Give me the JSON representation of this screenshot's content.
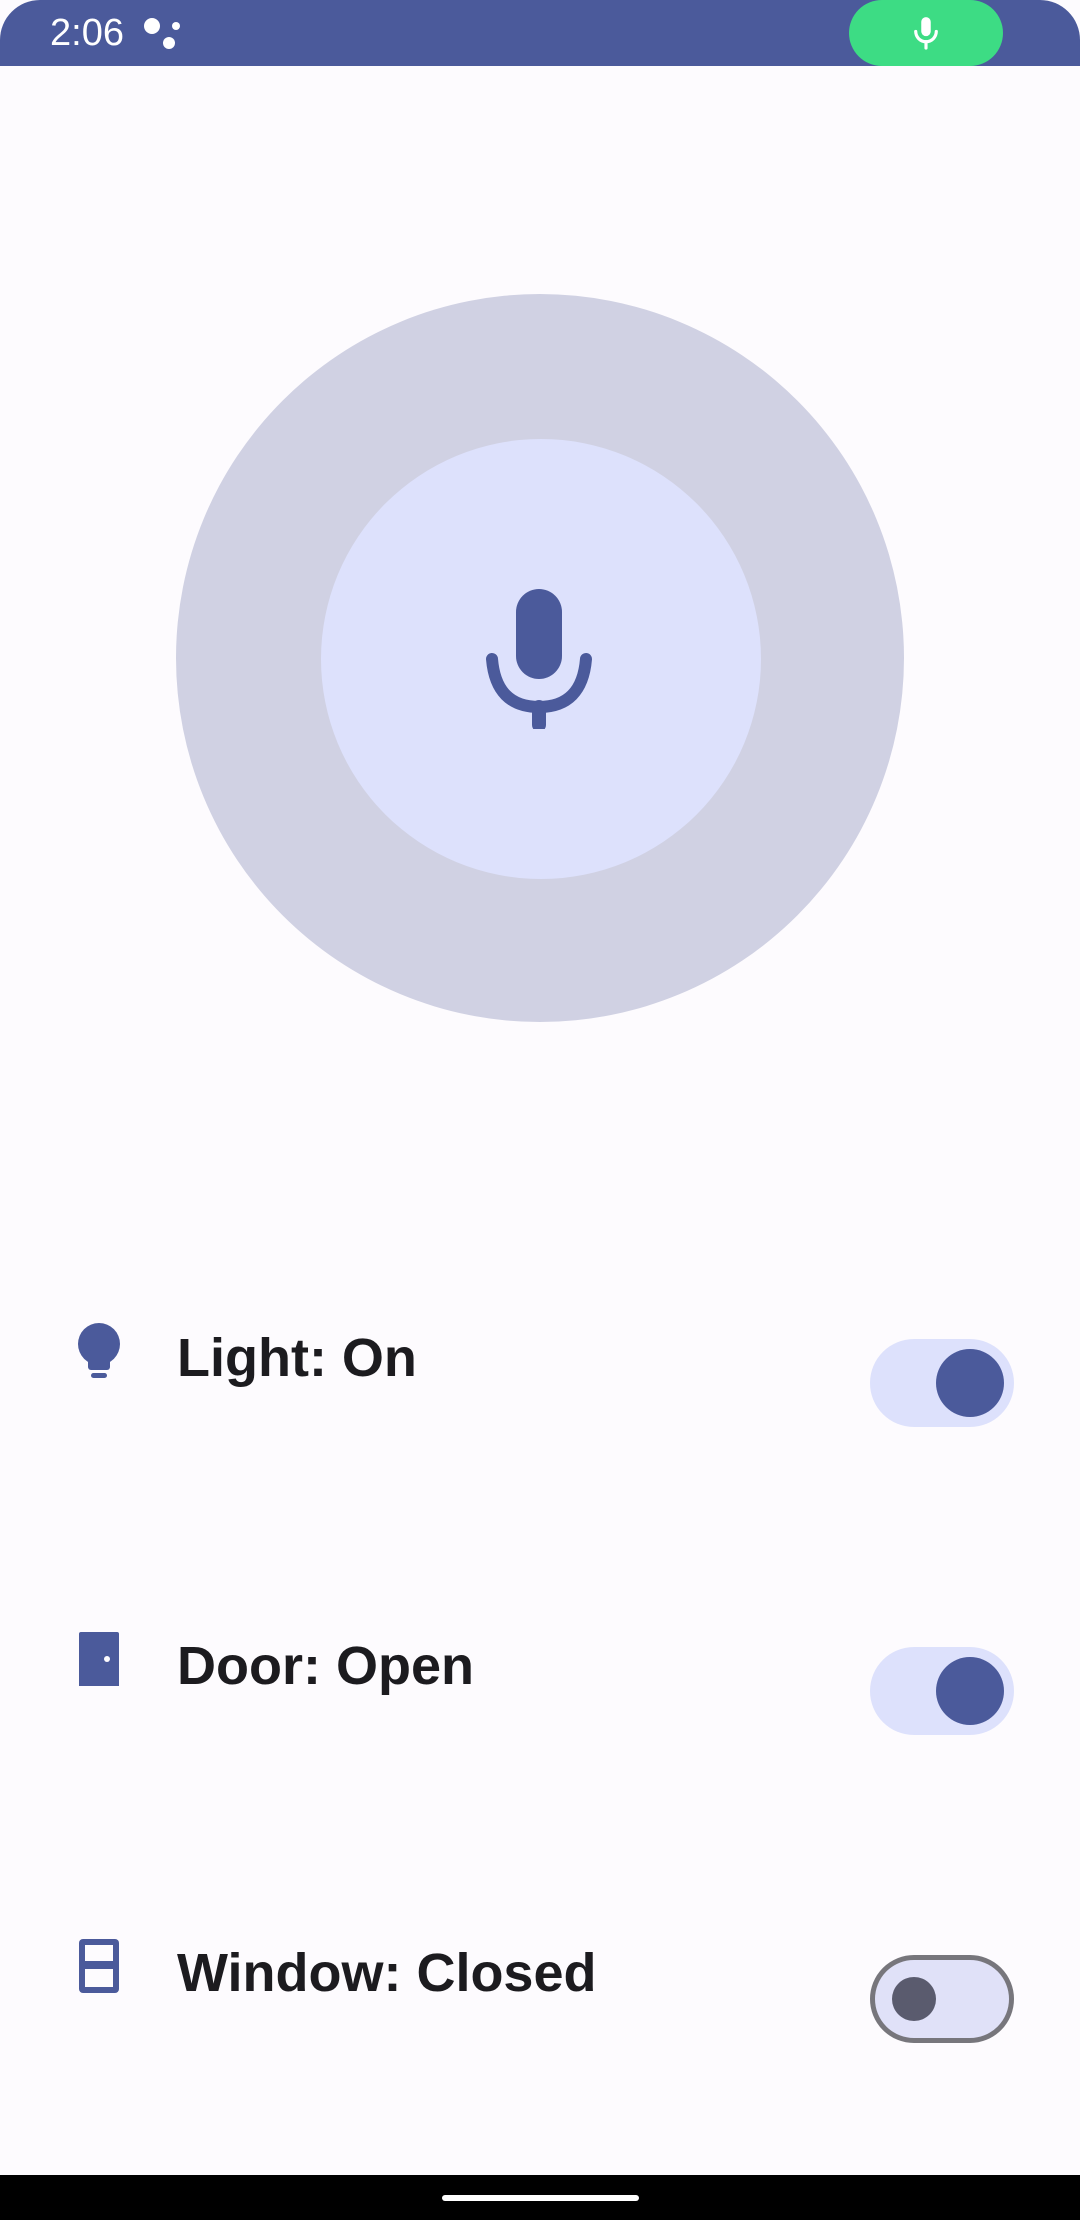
{
  "status_bar": {
    "time": "2:06",
    "background": "#4b5a9b",
    "mic_indicator_color": "#3ddc84"
  },
  "voice": {
    "icon": "mic-icon",
    "outer_color": "#d0d1e3",
    "inner_color": "#dde1fc",
    "icon_color": "#4b5a9b"
  },
  "devices": [
    {
      "icon": "lightbulb-icon",
      "label": "Light: On",
      "checked": true
    },
    {
      "icon": "door-icon",
      "label": "Door: Open",
      "checked": true
    },
    {
      "icon": "window-icon",
      "label": "Window: Closed",
      "checked": false
    }
  ],
  "colors": {
    "primary": "#4b5a9b",
    "background": "#fdfbfe",
    "text": "#1c1b1f"
  }
}
